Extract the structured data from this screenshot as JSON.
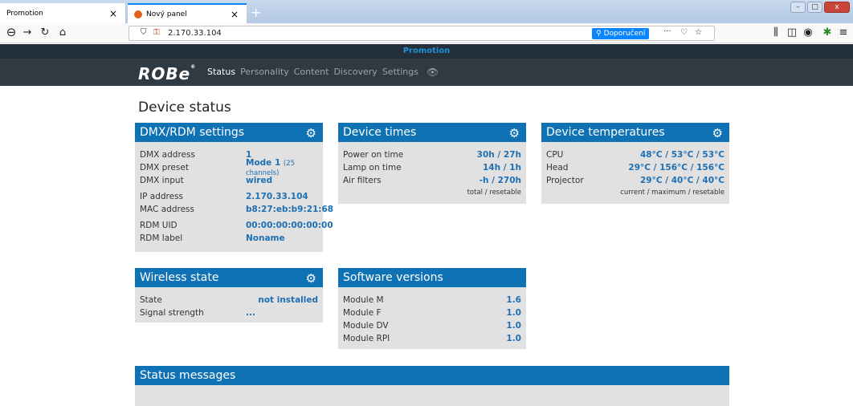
{
  "browser": {
    "tabs": [
      {
        "title": "Promotion",
        "close": "×"
      },
      {
        "title": "Nový panel",
        "close": "×"
      }
    ],
    "new_tab": "+",
    "url": "2.170.33.104",
    "recommend_label": "Doporučení",
    "page_actions": "···"
  },
  "site": {
    "promo": "Promotion",
    "logo": "ROBe",
    "nav": [
      "Status",
      "Personality",
      "Content",
      "Discovery",
      "Settings"
    ],
    "active_nav": "Status"
  },
  "page": {
    "title": "Device status"
  },
  "dmx": {
    "title": "DMX/RDM settings",
    "rows": [
      {
        "label": "DMX address",
        "value": "1"
      },
      {
        "label": "DMX preset",
        "value": "Mode 1",
        "extra": "(25 channels)"
      },
      {
        "label": "DMX input",
        "value": "wired"
      },
      {
        "label": "IP address",
        "value": "2.170.33.104"
      },
      {
        "label": "MAC address",
        "value": "b8:27:eb:b9:21:68"
      },
      {
        "label": "RDM UID",
        "value": "00:00:00:00:00:00"
      },
      {
        "label": "RDM label",
        "value": "Noname"
      }
    ]
  },
  "times": {
    "title": "Device times",
    "rows": [
      {
        "label": "Power on time",
        "value": "30h / 27h"
      },
      {
        "label": "Lamp on time",
        "value": "14h / 1h"
      },
      {
        "label": "Air filters",
        "value": "-h / 270h"
      }
    ],
    "footnote": "total / resetable"
  },
  "temps": {
    "title": "Device temperatures",
    "rows": [
      {
        "label": "CPU",
        "value": "48°C / 53°C / 53°C"
      },
      {
        "label": "Head",
        "value": "29°C / 156°C / 156°C"
      },
      {
        "label": "Projector",
        "value": "29°C / 40°C / 40°C"
      }
    ],
    "footnote": "current / maximum / resetable"
  },
  "wireless": {
    "title": "Wireless state",
    "rows": [
      {
        "label": "State",
        "value": "not installed"
      },
      {
        "label": "Signal strength",
        "value": "..."
      }
    ]
  },
  "software": {
    "title": "Software versions",
    "rows": [
      {
        "label": "Module M",
        "value": "1.6"
      },
      {
        "label": "Module F",
        "value": "1.0"
      },
      {
        "label": "Module DV",
        "value": "1.0"
      },
      {
        "label": "Module RPI",
        "value": "1.0"
      }
    ]
  },
  "status": {
    "title": "Status messages"
  }
}
